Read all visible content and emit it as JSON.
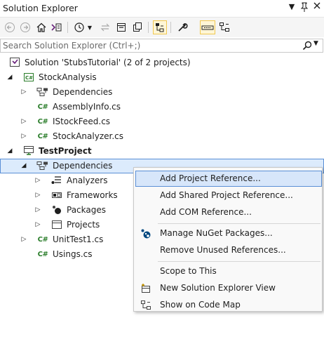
{
  "window": {
    "title": "Solution Explorer",
    "controls": [
      "dropdown-icon",
      "pin-icon",
      "close-icon"
    ]
  },
  "toolbar": {
    "icons": [
      "back-icon",
      "forward-icon",
      "home-icon",
      "switch-views-icon",
      "history-icon",
      "dropdown-icon",
      "sync-icon",
      "collapse-all-icon",
      "show-all-files-icon",
      "track-active-icon",
      "properties-icon",
      "preview-icon",
      "code-map-icon"
    ]
  },
  "search": {
    "placeholder": "Search Solution Explorer (Ctrl+;)"
  },
  "tree": {
    "solution": "Solution 'StubsTutorial' (2 of 2 projects)",
    "stock_analysis": "StockAnalysis",
    "sa_dependencies": "Dependencies",
    "assembly_info": "AssemblyInfo.cs",
    "istock_feed": "IStockFeed.cs",
    "stock_analyzer": "StockAnalyzer.cs",
    "test_project": "TestProject",
    "tp_dependencies": "Dependencies",
    "analyzers": "Analyzers",
    "frameworks": "Frameworks",
    "packages": "Packages",
    "projects": "Projects",
    "unit_test1": "UnitTest1.cs",
    "usings": "Usings.cs",
    "cs_badge": "C#"
  },
  "context_menu": {
    "add_project_reference": "Add Project Reference...",
    "add_shared_project_reference": "Add Shared Project Reference...",
    "add_com_reference": "Add COM Reference...",
    "manage_nuget": "Manage NuGet Packages...",
    "remove_unused": "Remove Unused References...",
    "scope_to_this": "Scope to This",
    "new_se_view": "New Solution Explorer View",
    "show_on_code_map": "Show on Code Map"
  },
  "colors": {
    "selection_bg": "#dcebfc",
    "selection_border": "#5a8fd6",
    "csharp_green": "#2a7d2a",
    "vs_purple": "#68217a"
  }
}
